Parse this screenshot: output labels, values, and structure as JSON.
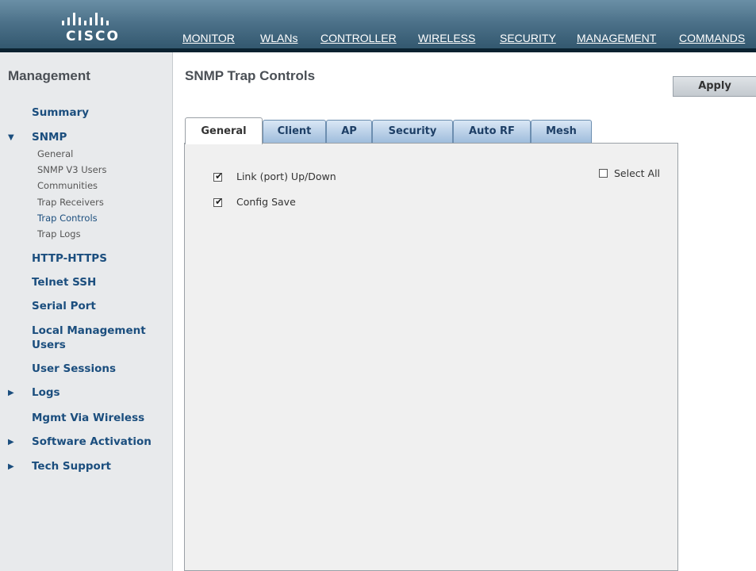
{
  "brand": {
    "logo_text": "CISCO",
    "logo_icon": "cisco-bridge-bars-icon"
  },
  "nav": {
    "items": [
      {
        "label": "MONITOR"
      },
      {
        "label": "WLANs"
      },
      {
        "label": "CONTROLLER"
      },
      {
        "label": "WIRELESS"
      },
      {
        "label": "SECURITY"
      },
      {
        "label": "MANAGEMENT",
        "active": true
      },
      {
        "label": "COMMANDS"
      }
    ]
  },
  "sidebar": {
    "title": "Management",
    "items": {
      "summary": "Summary",
      "snmp": "SNMP",
      "http": "HTTP-HTTPS",
      "telnet": "Telnet SSH",
      "serial": "Serial Port",
      "local_mgmt_1": "Local Management",
      "local_mgmt_2": "Users",
      "sessions": "User Sessions",
      "logs": "Logs",
      "mgmt_wireless": "Mgmt Via Wireless",
      "software": "Software Activation",
      "tech": "Tech Support"
    },
    "snmp_sub": {
      "general": "General",
      "v3users": "SNMP V3 Users",
      "communities": "Communities",
      "receivers": "Trap Receivers",
      "controls": "Trap Controls",
      "logs": "Trap Logs"
    }
  },
  "main": {
    "title": "SNMP Trap Controls",
    "apply_label": "Apply",
    "tabs": [
      "General",
      "Client",
      "AP",
      "Security",
      "Auto RF",
      "Mesh"
    ],
    "active_tab": "General",
    "options": [
      {
        "label": "Link (port) Up/Down",
        "checked": true
      },
      {
        "label": "Config Save",
        "checked": true
      }
    ],
    "select_all": {
      "label": "Select All",
      "checked": false
    }
  },
  "colors": {
    "accent": "#f79a1c",
    "link": "#1b4e7e",
    "header": "#4b7088"
  }
}
